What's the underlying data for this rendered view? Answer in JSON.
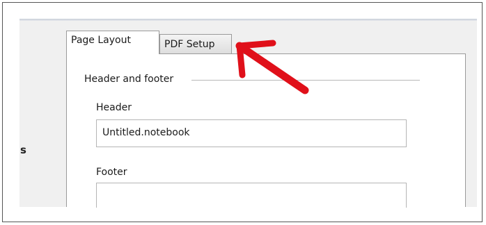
{
  "dialog": {
    "side_label": "s",
    "tabs": [
      {
        "label": "Page Layout",
        "selected": true
      },
      {
        "label": "PDF Setup",
        "selected": false
      }
    ],
    "group": {
      "label": "Header and footer",
      "fields": {
        "header": {
          "label": "Header",
          "value": "Untitled.notebook"
        },
        "footer": {
          "label": "Footer",
          "value": ""
        }
      }
    }
  },
  "annotation": {
    "icon": "arrow-icon",
    "color": "#e0101a"
  }
}
